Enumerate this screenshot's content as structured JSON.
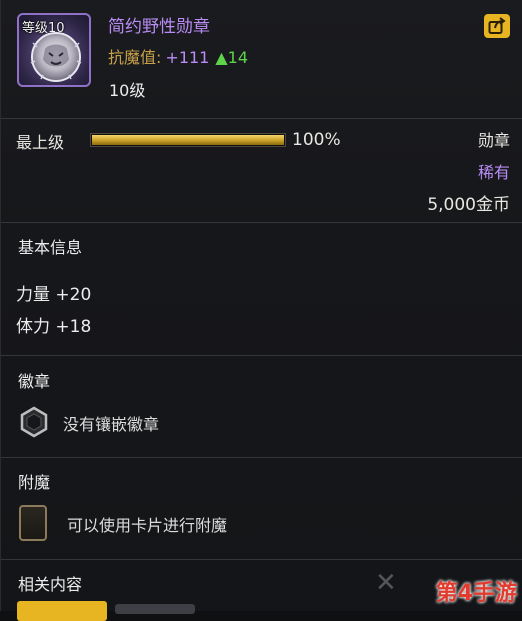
{
  "item": {
    "level_tag": "等级10",
    "name": "简约野性勋章",
    "magic_resist_label": "抗魔值:",
    "magic_resist_value": "+111",
    "magic_resist_change": "▲14",
    "level_text": "10级",
    "icon": "wolf-emblem-icon",
    "rarity_color": "#b98cf5"
  },
  "share": {
    "icon": "share-icon"
  },
  "upgrade": {
    "label": "最上级",
    "progress": 1.0,
    "percent_text": "100%"
  },
  "meta": {
    "type": "勋章",
    "rarity": "稀有",
    "price": "5,000金币"
  },
  "basic_info": {
    "title": "基本信息",
    "stats": [
      "力量 +20",
      "体力 +18"
    ]
  },
  "emblem": {
    "title": "徽章",
    "empty_text": "没有镶嵌徽章",
    "icon": "emblem-socket-icon"
  },
  "enchant": {
    "title": "附魔",
    "hint_text": "可以使用卡片进行附魔",
    "icon": "card-slot-icon"
  },
  "related": {
    "title": "相关内容"
  },
  "watermark": {
    "text": "第4手游"
  },
  "colors": {
    "accent_gold": "#e7b521",
    "purple": "#b98cf5",
    "green": "#5fd34a"
  }
}
